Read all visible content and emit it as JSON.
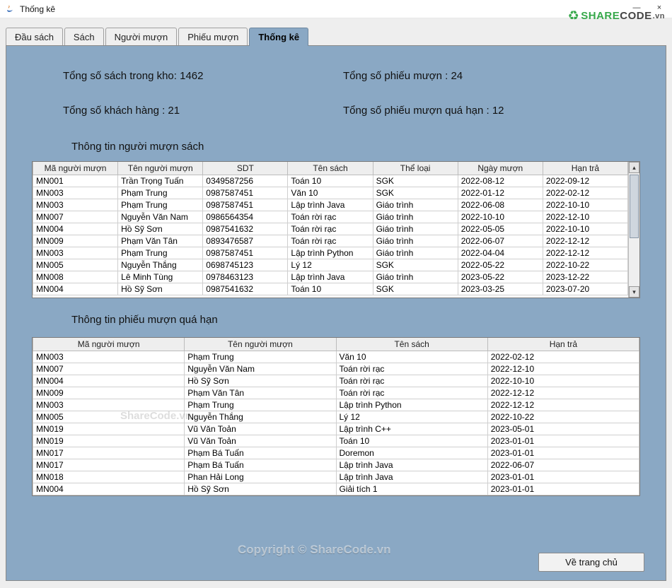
{
  "window": {
    "title": "Thống kê",
    "minimize": "—",
    "close": "×"
  },
  "watermark": {
    "share": "SHARE",
    "code": "CODE",
    "vn": ".vn",
    "center1": "ShareCode.vn",
    "center2": "Copyright © ShareCode.vn"
  },
  "tabs": [
    {
      "label": "Đầu sách",
      "active": false
    },
    {
      "label": "Sách",
      "active": false
    },
    {
      "label": "Người mượn",
      "active": false
    },
    {
      "label": "Phiếu mượn",
      "active": false
    },
    {
      "label": "Thống kê",
      "active": true
    }
  ],
  "stats": {
    "total_books": "Tổng số sách trong kho: 1462",
    "total_loans": "Tổng số phiếu mượn : 24",
    "total_customers": "Tổng số khách hàng : 21",
    "total_overdue": "Tổng số phiếu mượn quá hạn : 12"
  },
  "section1": {
    "title": "Thông tin người mượn sách",
    "columns": [
      "Mã người mượn",
      "Tên người mượn",
      "SDT",
      "Tên sách",
      "Thể loại",
      "Ngày mượn",
      "Hạn trả"
    ],
    "rows": [
      [
        "MN001",
        "Trần Trọng Tuấn",
        "0349587256",
        "Toán 10",
        "SGK",
        "2022-08-12",
        "2022-09-12"
      ],
      [
        "MN003",
        "Phạm Trung",
        "0987587451",
        "Văn 10",
        "SGK",
        "2022-01-12",
        "2022-02-12"
      ],
      [
        "MN003",
        "Phạm Trung",
        "0987587451",
        "Lập trình Java",
        "Giáo trình",
        "2022-06-08",
        "2022-10-10"
      ],
      [
        "MN007",
        "Nguyễn Văn Nam",
        "0986564354",
        "Toán rời rạc",
        "Giáo trình",
        "2022-10-10",
        "2022-12-10"
      ],
      [
        "MN004",
        "Hồ Sỹ Sơn",
        "0987541632",
        "Toán rời rạc",
        "Giáo trình",
        "2022-05-05",
        "2022-10-10"
      ],
      [
        "MN009",
        "Phạm Văn Tân",
        "0893476587",
        "Toán rời rạc",
        "Giáo trình",
        "2022-06-07",
        "2022-12-12"
      ],
      [
        "MN003",
        "Phạm Trung",
        "0987587451",
        "Lập trình Python",
        "Giáo trình",
        "2022-04-04",
        "2022-12-12"
      ],
      [
        "MN005",
        "Nguyễn Thắng",
        "0698745123",
        "Lý 12",
        "SGK",
        "2022-05-22",
        "2022-10-22"
      ],
      [
        "MN008",
        "Lê Minh Tùng",
        "0978463123",
        "Lập trình Java",
        "Giáo trình",
        "2023-05-22",
        "2023-12-22"
      ],
      [
        "MN004",
        "Hồ Sỹ Sơn",
        "0987541632",
        "Toán 10",
        "SGK",
        "2023-03-25",
        "2023-07-20"
      ]
    ]
  },
  "section2": {
    "title": "Thông tin phiếu mượn quá hạn",
    "columns": [
      "Mã người mượn",
      "Tên người mượn",
      "Tên sách",
      "Hạn trả"
    ],
    "rows": [
      [
        "MN003",
        "Phạm Trung",
        "Văn 10",
        "2022-02-12"
      ],
      [
        "MN007",
        "Nguyễn Văn Nam",
        "Toán rời rạc",
        "2022-12-10"
      ],
      [
        "MN004",
        "Hồ Sỹ Sơn",
        "Toán rời rạc",
        "2022-10-10"
      ],
      [
        "MN009",
        "Phạm Văn Tân",
        "Toán rời rạc",
        "2022-12-12"
      ],
      [
        "MN003",
        "Phạm Trung",
        "Lập trình Python",
        "2022-12-12"
      ],
      [
        "MN005",
        "Nguyễn Thắng",
        "Lý 12",
        "2022-10-22"
      ],
      [
        "MN019",
        "Vũ Văn Toản",
        "Lập trình C++",
        "2023-05-01"
      ],
      [
        "MN019",
        "Vũ Văn Toản",
        "Toán 10",
        "2023-01-01"
      ],
      [
        "MN017",
        "Phạm Bá Tuấn",
        "Doremon",
        "2023-01-01"
      ],
      [
        "MN017",
        "Phạm Bá Tuấn",
        "Lập trình Java",
        "2022-06-07"
      ],
      [
        "MN018",
        "Phan Hải Long",
        "Lập trình Java",
        "2023-01-01"
      ],
      [
        "MN004",
        "Hồ Sỹ Sơn",
        "Giải tích 1",
        "2023-01-01"
      ]
    ]
  },
  "buttons": {
    "home": "Về trang chủ"
  }
}
